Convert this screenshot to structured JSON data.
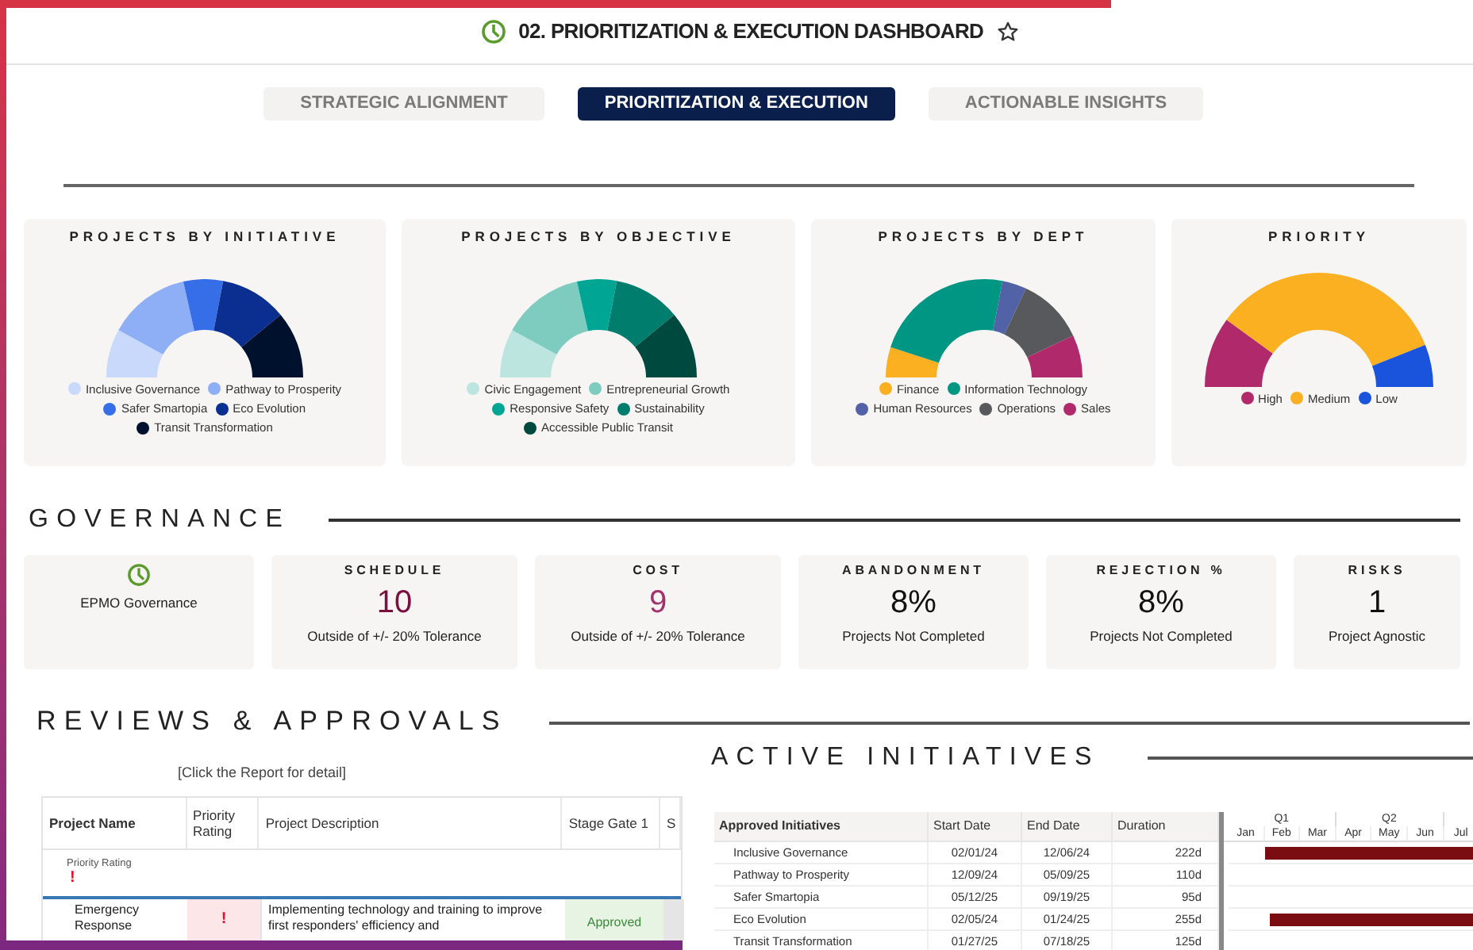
{
  "header": {
    "title": "02. PRIORITIZATION & EXECUTION DASHBOARD"
  },
  "tabs": [
    {
      "label": "STRATEGIC ALIGNMENT",
      "selected": false
    },
    {
      "label": "PRIORITIZATION & EXECUTION",
      "selected": true
    },
    {
      "label": "ACTIONABLE INSIGHTS",
      "selected": false
    }
  ],
  "charts": [
    {
      "title": "PROJECTS BY INITIATIVE",
      "legend": [
        {
          "label": "Inclusive Governance",
          "color": "#c9d9fb"
        },
        {
          "label": "Pathway to Prosperity",
          "color": "#8eaef5"
        },
        {
          "label": "Safer Smartopia",
          "color": "#356ee6"
        },
        {
          "label": "Eco Evolution",
          "color": "#0a2f91"
        },
        {
          "label": "Transit Transformation",
          "color": "#00112e"
        }
      ]
    },
    {
      "title": "PROJECTS BY OBJECTIVE",
      "legend": [
        {
          "label": "Civic Engagement",
          "color": "#bde5df"
        },
        {
          "label": "Entrepreneurial Growth",
          "color": "#7ecbc0"
        },
        {
          "label": "Responsive Safety",
          "color": "#00a693"
        },
        {
          "label": "Sustainability",
          "color": "#007d6c"
        },
        {
          "label": "Accessible Public Transit",
          "color": "#00493f"
        }
      ]
    },
    {
      "title": "PROJECTS BY DEPT",
      "legend": [
        {
          "label": "Finance",
          "color": "#fbb022"
        },
        {
          "label": "Information Technology",
          "color": "#009684"
        },
        {
          "label": "Human Resources",
          "color": "#5262a6"
        },
        {
          "label": "Operations",
          "color": "#57595d"
        },
        {
          "label": "Sales",
          "color": "#b02a6b"
        }
      ]
    },
    {
      "title": "PRIORITY",
      "legend": [
        {
          "label": "High",
          "color": "#b02a6b"
        },
        {
          "label": "Medium",
          "color": "#fbb022"
        },
        {
          "label": "Low",
          "color": "#1a54dc"
        }
      ]
    }
  ],
  "governance": {
    "heading": "GOVERNANCE",
    "summary": {
      "label": "EPMO Governance"
    },
    "kpis": [
      {
        "title": "SCHEDULE",
        "value": "10",
        "note": "Outside of +/- 20% Tolerance",
        "color": "#7a1040"
      },
      {
        "title": "COST",
        "value": "9",
        "note": "Outside of +/- 20% Tolerance",
        "color": "#a3336e"
      },
      {
        "title": "ABANDONMENT",
        "value": "8%",
        "note": "Projects Not Completed",
        "color": "#111111"
      },
      {
        "title": "REJECTION %",
        "value": "8%",
        "note": "Projects Not Completed",
        "color": "#111111"
      },
      {
        "title": "RISKS",
        "value": "1",
        "note": "Project Agnostic",
        "color": "#111111"
      }
    ]
  },
  "reviews": {
    "heading": "REVIEWS & APPROVALS",
    "hint": "[Click the Report for detail]",
    "columns": [
      "Project Name",
      "Priority Rating",
      "Project Description",
      "Stage Gate 1",
      "S"
    ],
    "filter": {
      "label": "Priority Rating",
      "mark": "!"
    },
    "rows": [
      {
        "project_name": "Emergency Response",
        "priority": "!",
        "description": "Implementing technology and training to improve first responders' efficiency and",
        "stage_gate_1": "Approved"
      }
    ]
  },
  "initiatives": {
    "heading": "ACTIVE INITIATIVES",
    "columns": [
      "Approved Initiatives",
      "Start Date",
      "End Date",
      "Duration"
    ],
    "quarters": [
      "Q1",
      "Q2"
    ],
    "months": [
      "Jan",
      "Feb",
      "Mar",
      "Apr",
      "May",
      "Jun",
      "Jul"
    ],
    "rows": [
      {
        "name": "Inclusive Governance",
        "start": "02/01/24",
        "end": "12/06/24",
        "duration": "222d"
      },
      {
        "name": "Pathway to Prosperity",
        "start": "12/09/24",
        "end": "05/09/25",
        "duration": "110d"
      },
      {
        "name": "Safer Smartopia",
        "start": "05/12/25",
        "end": "09/19/25",
        "duration": "95d"
      },
      {
        "name": "Eco Evolution",
        "start": "02/05/24",
        "end": "01/24/25",
        "duration": "255d"
      },
      {
        "name": "Transit Transformation",
        "start": "01/27/25",
        "end": "07/18/25",
        "duration": "125d"
      }
    ]
  }
}
